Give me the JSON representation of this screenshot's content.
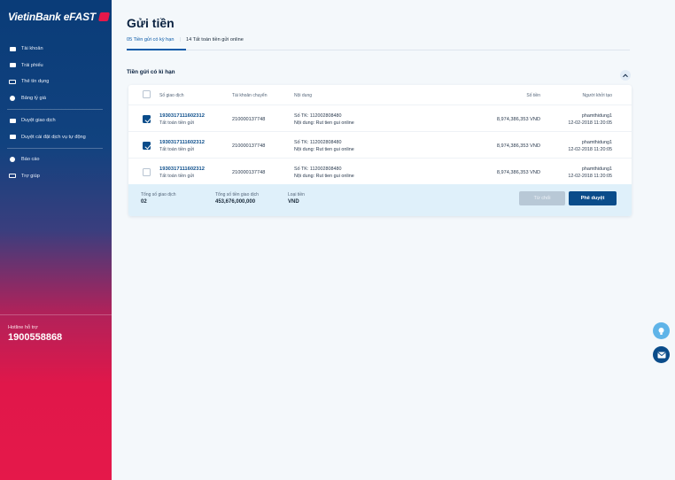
{
  "sidebar": {
    "logo": "VietinBank eFAST",
    "items": [
      {
        "label": "Tài khoản",
        "icon": "wallet-icon"
      },
      {
        "label": "Trái phiếu",
        "icon": "bond-icon"
      },
      {
        "label": "Thẻ tín dụng",
        "icon": "credit-card-icon"
      },
      {
        "label": "Bảng tỷ giá",
        "icon": "exchange-rate-icon"
      },
      {
        "label": "Duyệt giao dịch",
        "icon": "approve-transaction-icon"
      },
      {
        "label": "Duyệt cài đặt dịch vụ tự động",
        "icon": "auto-service-icon"
      },
      {
        "label": "Báo cáo",
        "icon": "report-icon"
      },
      {
        "label": "Trợ giúp",
        "icon": "help-icon"
      }
    ],
    "hotline_label": "Hotline hỗ trợ",
    "hotline_number": "1900558868"
  },
  "page": {
    "title": "Gửi tiền",
    "tabs": [
      {
        "label": "05 Tiền gửi có kỳ hạn",
        "active": true
      },
      {
        "label": "14 Tất toán tiền gửi online",
        "active": false
      }
    ],
    "section_title": "Tiền gửi có kì hạn"
  },
  "table": {
    "headers": {
      "code": "Số giao dịch",
      "account": "Tài khoản chuyển",
      "content": "Nội dung",
      "amount": "Số tiền",
      "creator": "Người khởi tạo"
    },
    "rows": [
      {
        "checked": true,
        "code": "1930317111602312",
        "type": "Tất toán tiền gửi",
        "account": "210000137748",
        "note1": "Số TK: 112002808480",
        "note2": "Nội dung: Rut tien gui online",
        "amount": "8,974,386,353 VND",
        "creator": "phamthidung1",
        "date": "12-02-2018 11:20:05"
      },
      {
        "checked": true,
        "code": "1930317111602312",
        "type": "Tất toán tiền gửi",
        "account": "210000137748",
        "note1": "Số TK: 112002808480",
        "note2": "Nội dung: Rut tien gui online",
        "amount": "8,974,386,353 VND",
        "creator": "phamthidung1",
        "date": "12-02-2018 11:20:05"
      },
      {
        "checked": false,
        "code": "1930317111602312",
        "type": "Tất toán tiền gửi",
        "account": "210000137748",
        "note1": "Số TK: 112002808480",
        "note2": "Nội dung: Rut tien gui online",
        "amount": "8,974,386,353 VND",
        "creator": "phamthidung1",
        "date": "12-02-2018 11:20:05"
      }
    ]
  },
  "summary": {
    "count_label": "Tổng số giao dịch",
    "count_value": "02",
    "total_label": "Tổng số tiền giao dịch",
    "total_value": "453,676,000,000",
    "currency_label": "Loại tiền",
    "currency_value": "VND",
    "reject_label": "Từ chối",
    "approve_label": "Phê duyệt"
  },
  "colors": {
    "primary": "#0a4c8a",
    "accent_red": "#e5184a",
    "footer_bg": "#dff0fa"
  }
}
